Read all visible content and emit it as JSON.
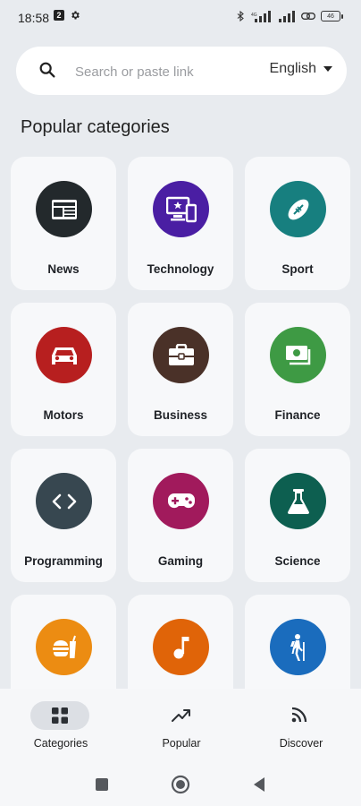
{
  "status_bar": {
    "time": "18:58",
    "badge": "2",
    "battery": "46"
  },
  "search": {
    "placeholder": "Search or paste link",
    "value": "",
    "language": "English"
  },
  "section_title": "Popular categories",
  "categories": [
    {
      "label": "News",
      "icon": "newspaper-icon",
      "color": "#23292c"
    },
    {
      "label": "Technology",
      "icon": "devices-icon",
      "color": "#4a1ea3"
    },
    {
      "label": "Sport",
      "icon": "football-icon",
      "color": "#177f7f"
    },
    {
      "label": "Motors",
      "icon": "car-icon",
      "color": "#b71f1f"
    },
    {
      "label": "Business",
      "icon": "briefcase-icon",
      "color": "#4a3128"
    },
    {
      "label": "Finance",
      "icon": "money-icon",
      "color": "#3e9a44"
    },
    {
      "label": "Programming",
      "icon": "code-icon",
      "color": "#374750"
    },
    {
      "label": "Gaming",
      "icon": "gamepad-icon",
      "color": "#a11a5c"
    },
    {
      "label": "Science",
      "icon": "flask-icon",
      "color": "#0d5f50"
    },
    {
      "label": "",
      "icon": "fastfood-icon",
      "color": "#ec8c12"
    },
    {
      "label": "",
      "icon": "music-note-icon",
      "color": "#e06408"
    },
    {
      "label": "",
      "icon": "hiking-icon",
      "color": "#1a6cbd"
    }
  ],
  "bottom_nav": [
    {
      "label": "Categories",
      "icon": "grid-icon",
      "active": true
    },
    {
      "label": "Popular",
      "icon": "trending-icon",
      "active": false
    },
    {
      "label": "Discover",
      "icon": "rss-icon",
      "active": false
    }
  ]
}
